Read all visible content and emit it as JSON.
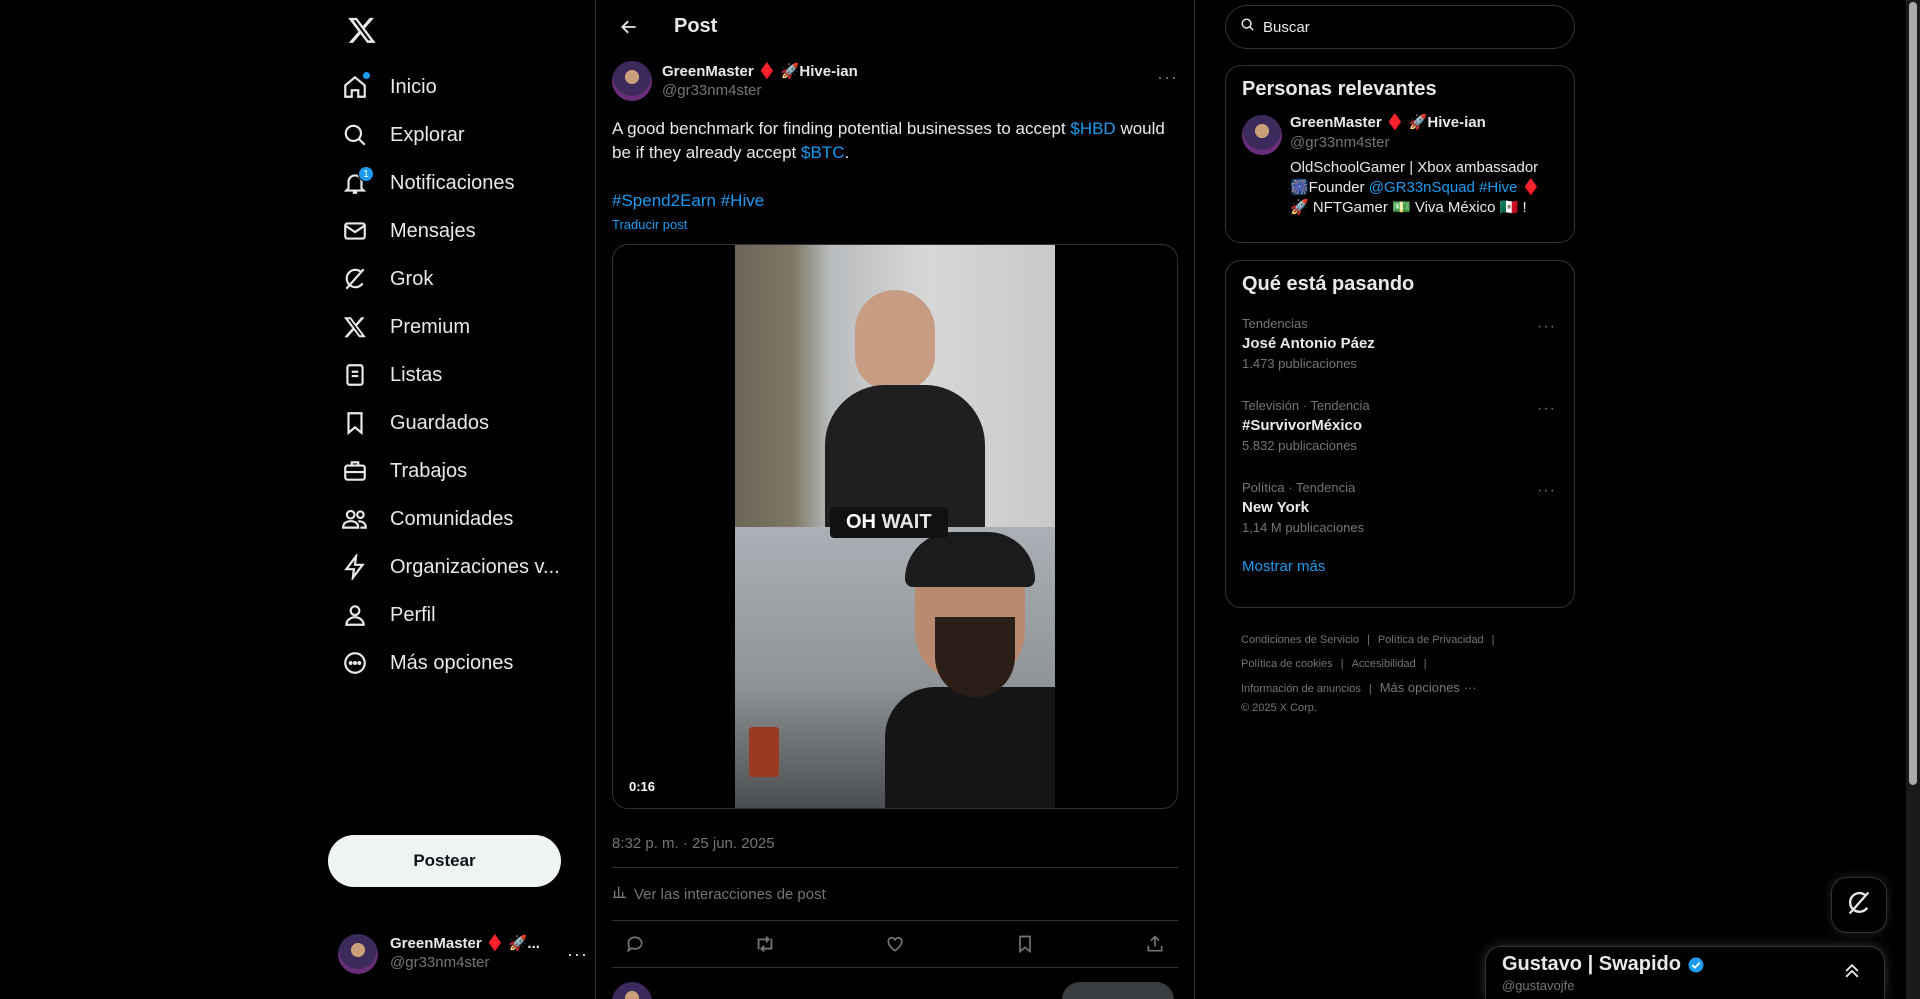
{
  "nav": {
    "items": [
      {
        "label": "Inicio",
        "icon": "home-icon"
      },
      {
        "label": "Explorar",
        "icon": "search-icon"
      },
      {
        "label": "Notificaciones",
        "icon": "bell-icon",
        "badge": "1"
      },
      {
        "label": "Mensajes",
        "icon": "mail-icon"
      },
      {
        "label": "Grok",
        "icon": "grok-icon"
      },
      {
        "label": "Premium",
        "icon": "x-logo-icon"
      },
      {
        "label": "Listas",
        "icon": "list-icon"
      },
      {
        "label": "Guardados",
        "icon": "bookmark-icon"
      },
      {
        "label": "Trabajos",
        "icon": "briefcase-icon"
      },
      {
        "label": "Comunidades",
        "icon": "people-icon"
      },
      {
        "label": "Organizaciones v...",
        "icon": "lightning-icon"
      },
      {
        "label": "Perfil",
        "icon": "person-icon"
      },
      {
        "label": "Más opciones",
        "icon": "more-circle-icon"
      }
    ],
    "post_button": "Postear",
    "account": {
      "name": "GreenMaster ♦️ 🚀...",
      "handle": "@gr33nm4ster",
      "more": "···"
    }
  },
  "main": {
    "header_title": "Post",
    "tweet": {
      "author_name": "GreenMaster ♦️ 🚀Hive-ian",
      "author_handle": "@gr33nm4ster",
      "more": "···",
      "text_part1": "A good benchmark for finding potential businesses to accept ",
      "cashtag1": "$HBD",
      "text_part2": " would be if they already accept ",
      "cashtag2": "$BTC",
      "text_part3": ".",
      "hashtag1": "#Spend2Earn",
      "hashtag2": "#Hive",
      "translate": "Traducir post",
      "video_caption_1": "OH",
      "video_caption_2": "WAIT",
      "video_duration": "0:16",
      "timestamp": "8:32 p. m. · 25 jun. 2025",
      "insights": "Ver las interacciones de post"
    }
  },
  "right": {
    "search_placeholder": "Buscar",
    "relevant": {
      "title": "Personas relevantes",
      "name": "GreenMaster ♦️ 🚀Hive-ian",
      "handle": "@gr33nm4ster",
      "bio_line1": "OldSchoolGamer | Xbox ambassador",
      "bio_line2_pre": "🎆Founder ",
      "bio_line2_link1": "@GR33nSquad",
      "bio_line2_link2": "#Hive",
      "bio_line2_post": " ♦️",
      "bio_line3": "🚀 NFTGamer 💵 Viva México 🇲🇽 !"
    },
    "trends": {
      "title": "Qué está pasando",
      "items": [
        {
          "category": "Tendencias",
          "name": "José Antonio Páez",
          "count": "1.473 publicaciones"
        },
        {
          "category": "Televisión · Tendencia",
          "name": "#SurvivorMéxico",
          "count": "5.832 publicaciones"
        },
        {
          "category": "Política · Tendencia",
          "name": "New York",
          "count": "1,14 M publicaciones"
        }
      ],
      "show_more": "Mostrar más"
    },
    "footer": {
      "links": [
        "Condiciones de Servicio",
        "Política de Privacidad",
        "Política de cookies",
        "Accesibilidad",
        "Información de anuncios",
        "Más opciones ···"
      ],
      "copyright": "© 2025 X Corp."
    }
  },
  "messages": {
    "name": "Gustavo | Swapido",
    "handle": "@gustavojfe"
  },
  "colors": {
    "accent": "#1d9bf0",
    "bg": "#000000",
    "text": "#e7e9ea",
    "muted": "#71767b"
  }
}
